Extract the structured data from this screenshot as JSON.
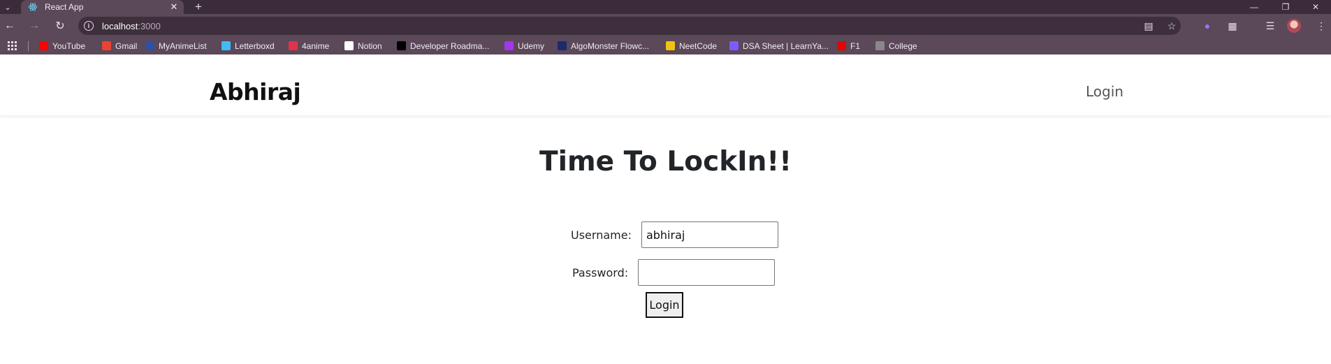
{
  "browser": {
    "tab": {
      "title": "React App"
    },
    "omnibox": {
      "host": "localhost",
      "port": ":3000"
    },
    "bookmarks": [
      {
        "label": "YouTube",
        "icon": "youtube-icon",
        "color": "#ff0000"
      },
      {
        "label": "Gmail",
        "icon": "gmail-icon",
        "color": "#ea4335"
      },
      {
        "label": "MyAnimeList",
        "icon": "myanimelist-icon",
        "color": "#2e51a2"
      },
      {
        "label": "Letterboxd",
        "icon": "letterboxd-icon",
        "color": "#40bcf4"
      },
      {
        "label": "4anime",
        "icon": "4anime-icon",
        "color": "#e0344a"
      },
      {
        "label": "Notion",
        "icon": "notion-icon",
        "color": "#ffffff"
      },
      {
        "label": "Developer Roadma...",
        "icon": "roadmap-icon",
        "color": "#000000"
      },
      {
        "label": "Udemy",
        "icon": "udemy-icon",
        "color": "#a435f0"
      },
      {
        "label": "AlgoMonster Flowc...",
        "icon": "algomonster-icon",
        "color": "#1c2b6b"
      },
      {
        "label": "NeetCode",
        "icon": "neetcode-icon",
        "color": "#f1c40f"
      },
      {
        "label": "DSA Sheet | LearnYa...",
        "icon": "dsa-sheet-icon",
        "color": "#7c5cff"
      },
      {
        "label": "F1",
        "icon": "f1-icon",
        "color": "#e10600"
      },
      {
        "label": "College",
        "icon": "college-icon",
        "color": "#888888"
      }
    ]
  },
  "app": {
    "brand": "Abhiraj",
    "nav_login": "Login",
    "heading": "Time To LockIn!!",
    "form": {
      "username_label": "Username:",
      "username_value": "abhiraj",
      "password_label": "Password:",
      "password_value": "",
      "submit_label": "Login"
    }
  }
}
